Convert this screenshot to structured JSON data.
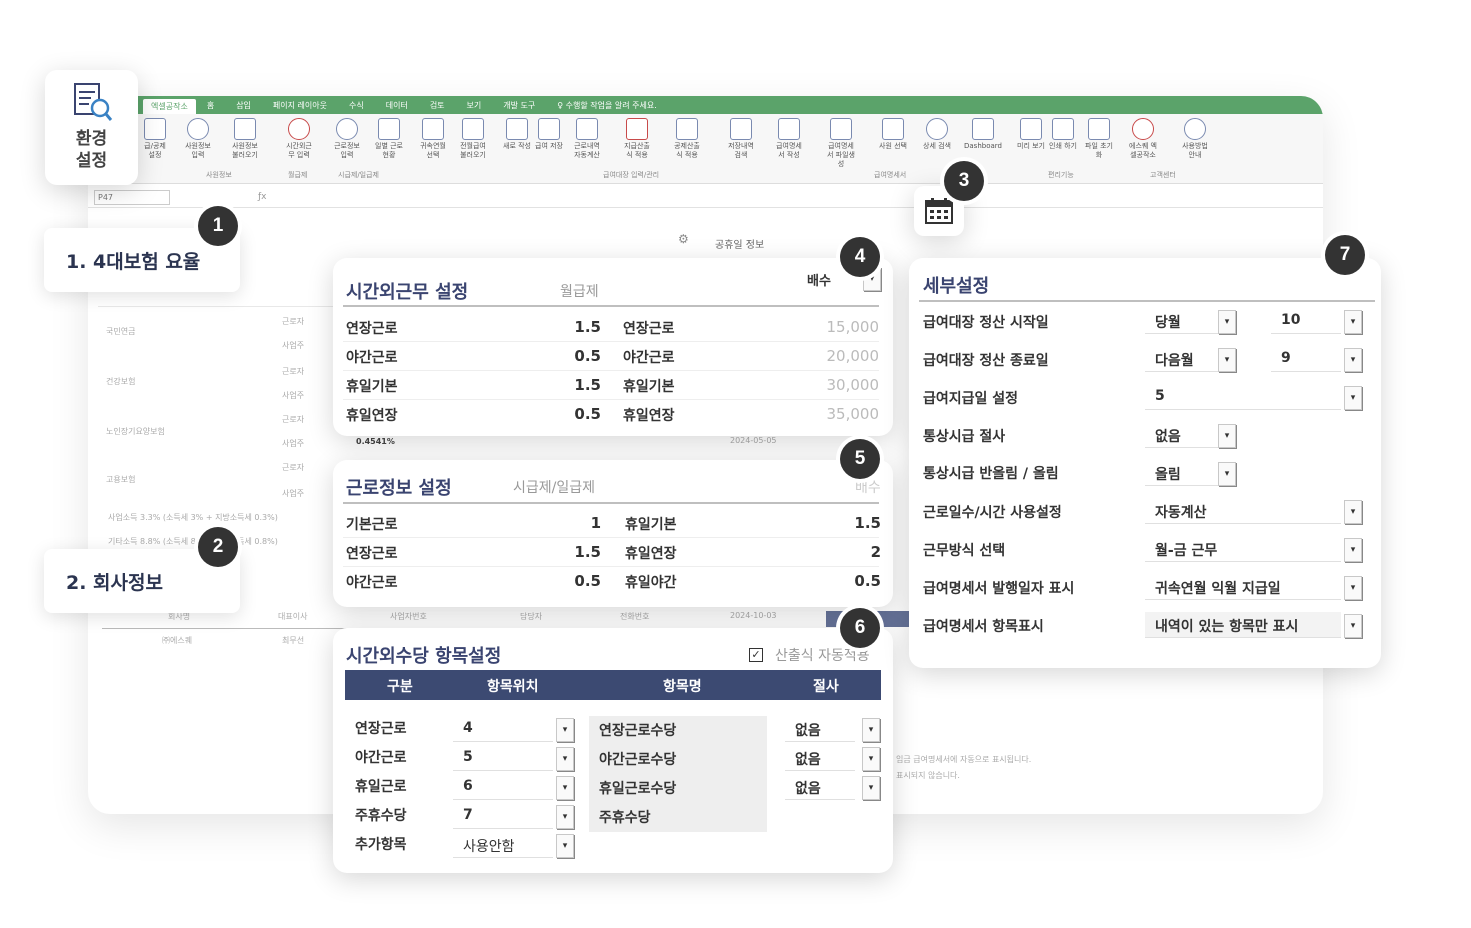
{
  "ribbon": {
    "tabs": [
      "엑셀공작소",
      "홈",
      "삽입",
      "페이지 레이아웃",
      "수식",
      "데이터",
      "검토",
      "보기",
      "개발 도구",
      "♀ 수행할 작업을 알려 주세요."
    ],
    "buttons": [
      "급/공제 설정",
      "사원정보 입력",
      "사원정보 불러오기",
      "시간외근무 입력",
      "근로정보 입력",
      "일별 근로현황",
      "귀속연월 선택",
      "전월급여 불러오기",
      "새로 작성",
      "급여 저장",
      "근로내역 자동계산",
      "지급산출식 적용",
      "공제산출식 적용",
      "저장내역 검색",
      "급여명세서 작성",
      "급여명세서 파일생성",
      "사원 선택",
      "상세 검색",
      "Dashboard",
      "미리 보기",
      "인쇄 하기",
      "파일 초기화",
      "에스퀘 엑셀공작소",
      "사용방법 안내"
    ],
    "groups": [
      "사원정보",
      "월급제",
      "시급제/일급제",
      "급여대장 입력/관리",
      "급여명세서",
      "편리기능",
      "고객센터"
    ]
  },
  "formula": {
    "namebox": "P47"
  },
  "env_button": {
    "label1": "환경",
    "label2": "설정"
  },
  "badges": [
    "1",
    "2",
    "3",
    "4",
    "5",
    "6",
    "7"
  ],
  "labels": {
    "insurance": "1. 4대보험 요율",
    "company": "2. 회사정보"
  },
  "background": {
    "holiday_info": "공휴일 정보",
    "rows": [
      "국민연금",
      "건강보험",
      "노인장기요양보험",
      "고용보험"
    ],
    "sub": [
      "근로자",
      "사업주"
    ],
    "tax1": "사업소득 3.3% (소득세 3% + 지방소득세 0.3%)",
    "tax2": "기타소득 8.8% (소득세 8% + 지방소득세 0.8%)",
    "company_headers": [
      "회사명",
      "대표이사",
      "사업자번호",
      "담당자",
      "전화번호"
    ],
    "company_values": [
      "㈜에스퀘",
      "최무선"
    ],
    "dates": [
      "2024-05-05",
      "2024-10-03"
    ],
    "rate": "0.4541%",
    "note": "임금 급여명세서에 자동으로 표시됩니다.",
    "note2": "표시되지 않습니다."
  },
  "overtime": {
    "title": "시간외근무 설정",
    "subtitle": "월급제",
    "mode": "배수",
    "left": [
      {
        "label": "연장근로",
        "value": "1.5"
      },
      {
        "label": "야간근로",
        "value": "0.5"
      },
      {
        "label": "휴일기본",
        "value": "1.5"
      },
      {
        "label": "휴일연장",
        "value": "0.5"
      }
    ],
    "right": [
      {
        "label": "연장근로",
        "value": "15,000"
      },
      {
        "label": "야간근로",
        "value": "20,000"
      },
      {
        "label": "휴일기본",
        "value": "30,000"
      },
      {
        "label": "휴일연장",
        "value": "35,000"
      }
    ]
  },
  "workinfo": {
    "title": "근로정보 설정",
    "subtitle": "시급제/일급제",
    "mode": "배수",
    "left": [
      {
        "label": "기본근로",
        "value": "1"
      },
      {
        "label": "연장근로",
        "value": "1.5"
      },
      {
        "label": "야간근로",
        "value": "0.5"
      }
    ],
    "right": [
      {
        "label": "휴일기본",
        "value": "1.5"
      },
      {
        "label": "휴일연장",
        "value": "2"
      },
      {
        "label": "휴일야간",
        "value": "0.5"
      }
    ]
  },
  "allowance": {
    "title": "시간외수당 항목설정",
    "auto_label": "산출식 자동적용",
    "headers": [
      "구분",
      "항목위치",
      "항목명",
      "절사"
    ],
    "rows": [
      {
        "type": "연장근로",
        "pos": "4",
        "name": "연장근로수당",
        "cut": "없음"
      },
      {
        "type": "야간근로",
        "pos": "5",
        "name": "야간근로수당",
        "cut": "없음"
      },
      {
        "type": "휴일근로",
        "pos": "6",
        "name": "휴일근로수당",
        "cut": "없음"
      },
      {
        "type": "주휴수당",
        "pos": "7",
        "name": "주휴수당",
        "cut": ""
      },
      {
        "type": "추가항목",
        "pos": "사용안함",
        "name": "",
        "cut": ""
      }
    ]
  },
  "detail": {
    "title": "세부설정",
    "rows": [
      {
        "label": "급여대장 정산 시작일",
        "v1": "당월",
        "v2": "10"
      },
      {
        "label": "급여대장 정산 종료일",
        "v1": "다음월",
        "v2": "9"
      },
      {
        "label": "급여지급일 설정",
        "v1": "5",
        "v2": ""
      },
      {
        "label": "통상시급 절사",
        "v1": "없음",
        "v2": ""
      },
      {
        "label": "통상시급 반올림 / 올림",
        "v1": "올림",
        "v2": ""
      },
      {
        "label": "근로일수/시간 사용설정",
        "v1": "자동계산",
        "v2": ""
      },
      {
        "label": "근무방식 선택",
        "v1": "월-금 근무",
        "v2": ""
      },
      {
        "label": "급여명세서 발행일자 표시",
        "v1": "귀속연월 익월 지급일",
        "v2": ""
      },
      {
        "label": "급여명세서 항목표시",
        "v1": "내역이 있는 항목만 표시",
        "v2": ""
      }
    ]
  },
  "calendar_icon": "calendar-icon",
  "colors": {
    "ribbon": "#5ba36a",
    "header": "#3c4a72",
    "badge": "#333333",
    "title": "#3a4470"
  }
}
